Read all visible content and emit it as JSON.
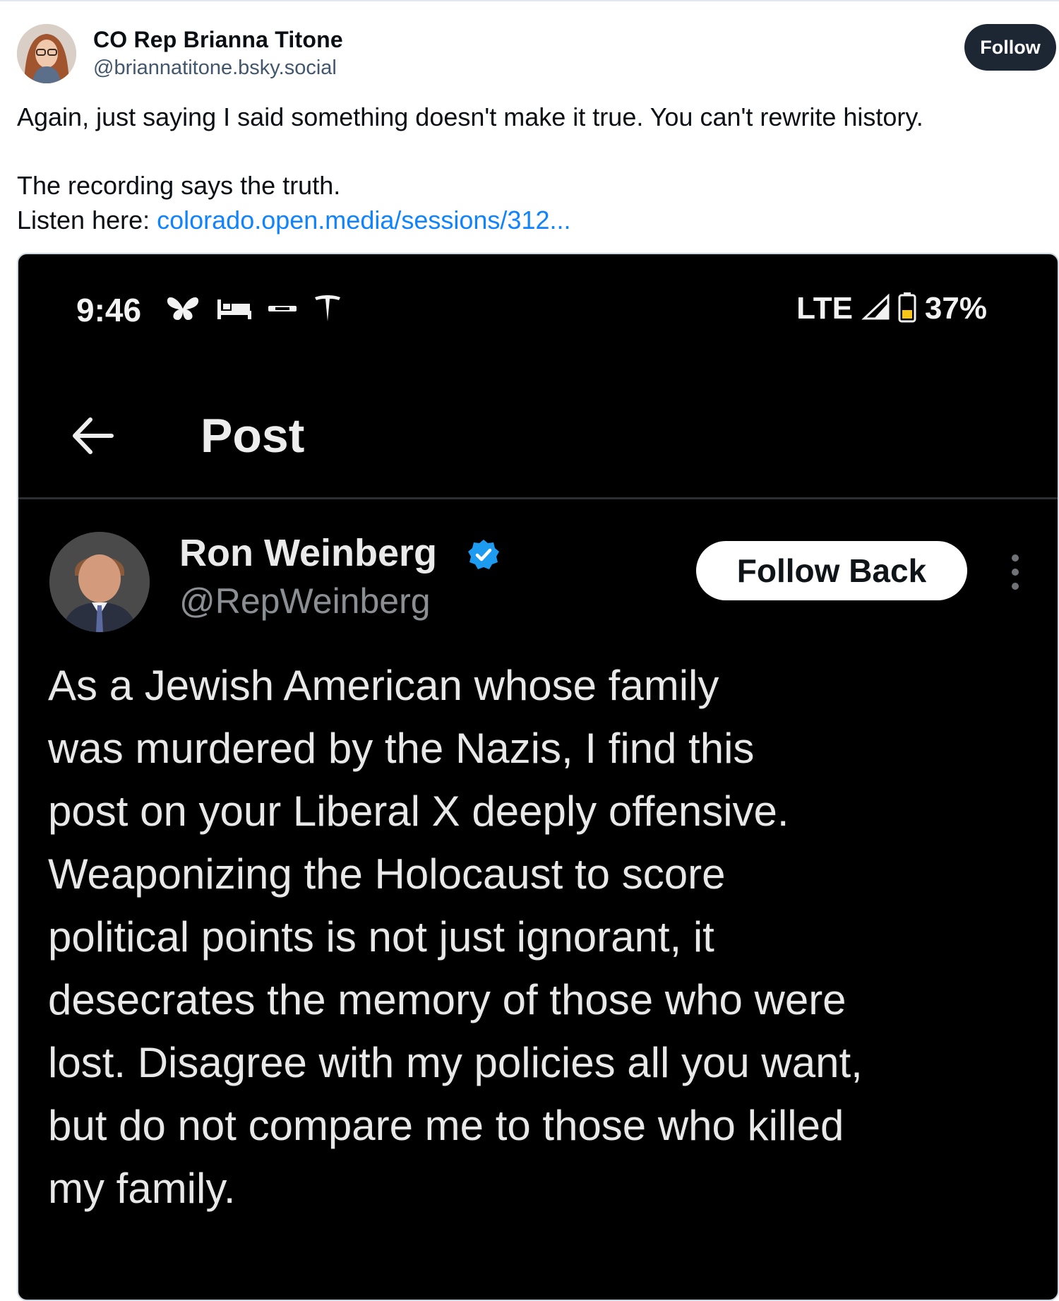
{
  "post": {
    "author_name": "CO Rep Brianna Titone",
    "author_handle": "@briannatitone.bsky.social",
    "follow_label": "Follow",
    "text_line1": "Again, just saying I said something doesn't make it true. You can't rewrite history.",
    "text_line2": "The recording says the truth.",
    "text_line3_prefix": "Listen here: ",
    "link_text": "colorado.open.media/sessions/312..."
  },
  "embedded_screenshot": {
    "status_bar": {
      "time": "9:46",
      "network": "LTE",
      "battery": "37%",
      "icons": [
        "butterfly-icon",
        "bed-icon",
        "lanex-icon",
        "tesla-icon",
        "signal-icon",
        "battery-icon"
      ]
    },
    "screen_title": "Post",
    "tweet": {
      "name": "Ron Weinberg",
      "handle": "@RepWeinberg",
      "verified": true,
      "follow_back_label": "Follow Back",
      "lines": [
        "As a Jewish American whose family",
        "was murdered by the Nazis, I find this",
        "post on your Liberal X deeply offensive.",
        "Weaponizing the Holocaust to score",
        "political points is not just ignorant, it",
        "desecrates the memory of those who were",
        "lost. Disagree with my policies all you want,",
        "but do not compare me to those who killed",
        "my family."
      ]
    }
  },
  "colors": {
    "link": "#1083fe",
    "follow_button_bg": "#1d2733",
    "verified_badge": "#1d9bf0",
    "embed_bg": "#000000"
  }
}
